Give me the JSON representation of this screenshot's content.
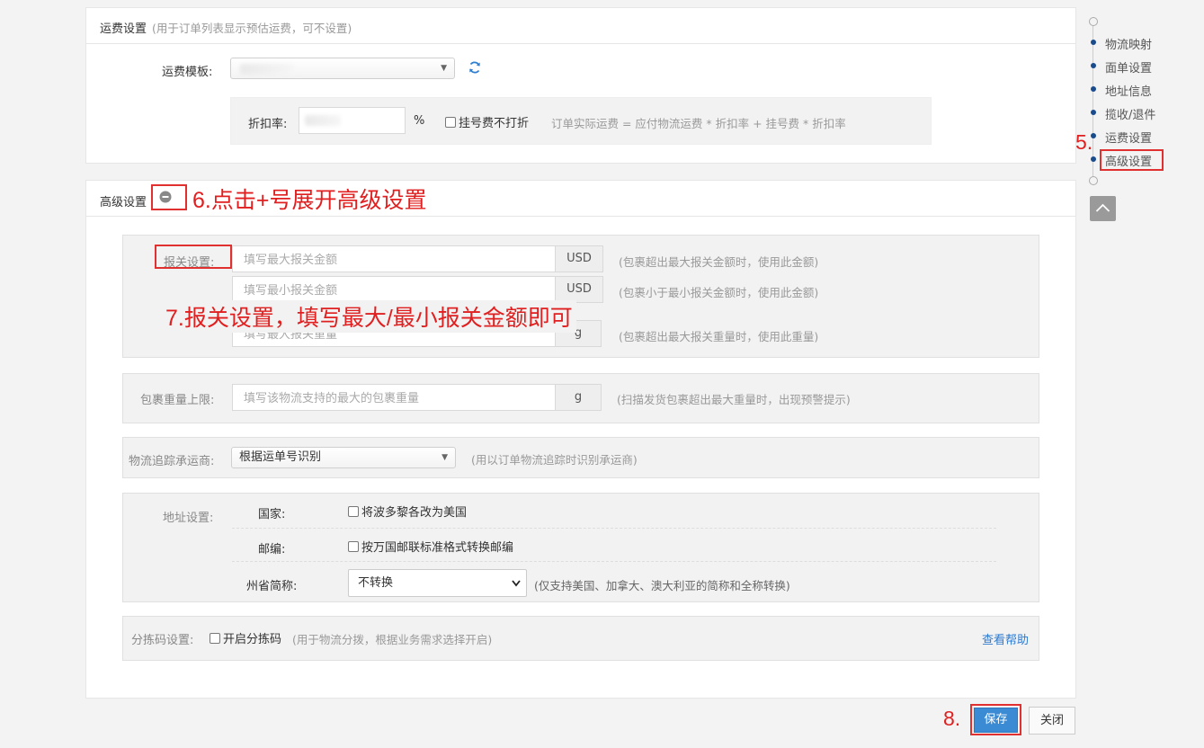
{
  "freight": {
    "title": "运费设置",
    "subtitle": "(用于订单列表显示预估运费，可不设置)",
    "template_label": "运费模板:",
    "discount_label": "折扣率:",
    "percent": "%",
    "registration_label": "挂号费不打折",
    "formula": "订单实际运费 = 应付物流运费 * 折扣率 + 挂号费 * 折扣率"
  },
  "advanced": {
    "title": "高级设置",
    "customs": {
      "label": "报关设置:",
      "max_amount_placeholder": "填写最大报关金额",
      "min_amount_placeholder": "填写最小报关金额",
      "max_weight_placeholder": "填写最大报关重量",
      "currency": "USD",
      "currency2": "USD",
      "weight_unit": "g",
      "max_amount_hint": "(包裹超出最大报关金额时，使用此金额)",
      "min_amount_hint": "(包裹小于最小报关金额时，使用此金额)",
      "max_weight_hint": "(包裹超出最大报关重量时，使用此重量)"
    },
    "weight_limit": {
      "label": "包裹重量上限:",
      "placeholder": "填写该物流支持的最大的包裹重量",
      "unit": "g",
      "hint": "(扫描发货包裹超出最大重量时，出现预警提示)"
    },
    "tracking": {
      "label": "物流追踪承运商:",
      "value": "根据运单号识别",
      "hint": "(用以订单物流追踪时识别承运商)"
    },
    "address": {
      "label": "地址设置:",
      "country_label": "国家:",
      "country_option": "将波多黎各改为美国",
      "zip_label": "邮编:",
      "zip_option": "按万国邮联标准格式转换邮编",
      "state_label": "州省简称:",
      "state_value": "不转换",
      "state_hint": "(仅支持美国、加拿大、澳大利亚的简称和全称转换)"
    },
    "sorting": {
      "label": "分拣码设置:",
      "option": "开启分拣码",
      "hint": "(用于物流分拨，根据业务需求选择开启)",
      "help": "查看帮助"
    }
  },
  "side_nav": {
    "items": [
      "物流映射",
      "面单设置",
      "地址信息",
      "揽收/退件",
      "运费设置",
      "高级设置"
    ]
  },
  "annotations": {
    "step5": "5.",
    "step6": "6.点击+号展开高级设置",
    "step7": "7.报关设置，填写最大/最小报关金额即可",
    "step8": "8."
  },
  "buttons": {
    "save": "保存",
    "close": "关闭"
  },
  "colors": {
    "accent": "#3a8ad4",
    "annotation": "#e02020",
    "nav_dot": "#1a4b8c"
  }
}
